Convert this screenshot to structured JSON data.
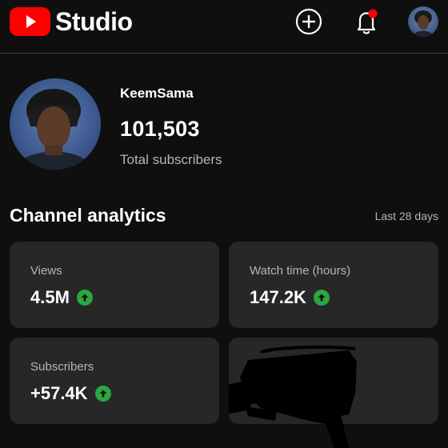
{
  "app": {
    "logo_text": "Studio"
  },
  "topbar": {
    "icons": [
      "create-icon",
      "notifications-icon",
      "account-avatar"
    ],
    "notification_dot_color": "#ff0000"
  },
  "channel": {
    "name": "KeemSama",
    "subscriber_count": "101,503",
    "subscriber_label": "Total subscribers"
  },
  "analytics": {
    "title": "Channel analytics",
    "period": "Last 28 days",
    "cards": [
      {
        "label": "Views",
        "value": "4.5M",
        "trend": "up"
      },
      {
        "label": "Watch time (hours)",
        "value": "147.2K",
        "trend": "up"
      },
      {
        "label": "Subscribers",
        "value": "+57.4K",
        "trend": "up"
      }
    ],
    "trend_color": "#2ba640"
  },
  "colors": {
    "background": "#0f0f0f",
    "card": "#272727",
    "brand_red": "#ff0000"
  }
}
